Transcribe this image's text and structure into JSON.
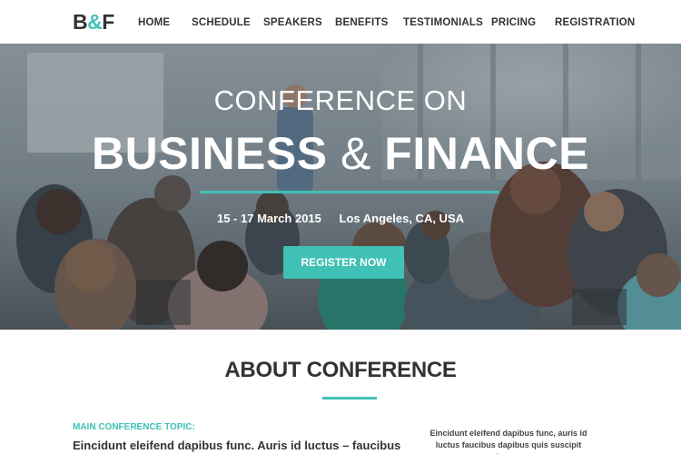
{
  "brand": {
    "logo_left": "B",
    "logo_amp": "&",
    "logo_right": "F"
  },
  "nav": {
    "items": [
      "Home",
      "Schedule",
      "Speakers",
      "Benefits",
      "Testimonials",
      "Pricing",
      "Registration"
    ]
  },
  "hero": {
    "line1": "CONFERENCE ON",
    "line2_left": "BUSINESS",
    "line2_amp": "&",
    "line2_right": "FINANCE",
    "date": "15 - 17 March 2015",
    "location": "Los Angeles, CA, USA",
    "button_label": "Register Now"
  },
  "about": {
    "title": "ABOUT CONFERENCE",
    "topic_label": "Main conference topic:",
    "topic_text": "Eincidunt eleifend dapibus func. Auris id luctus – faucibus",
    "right_text": "Eincidunt eleifend dapibus func, auris id luctus faucibus dapibus quis suscipit lorem."
  },
  "colors": {
    "accent": "#3fc1b5",
    "text": "#333333"
  }
}
